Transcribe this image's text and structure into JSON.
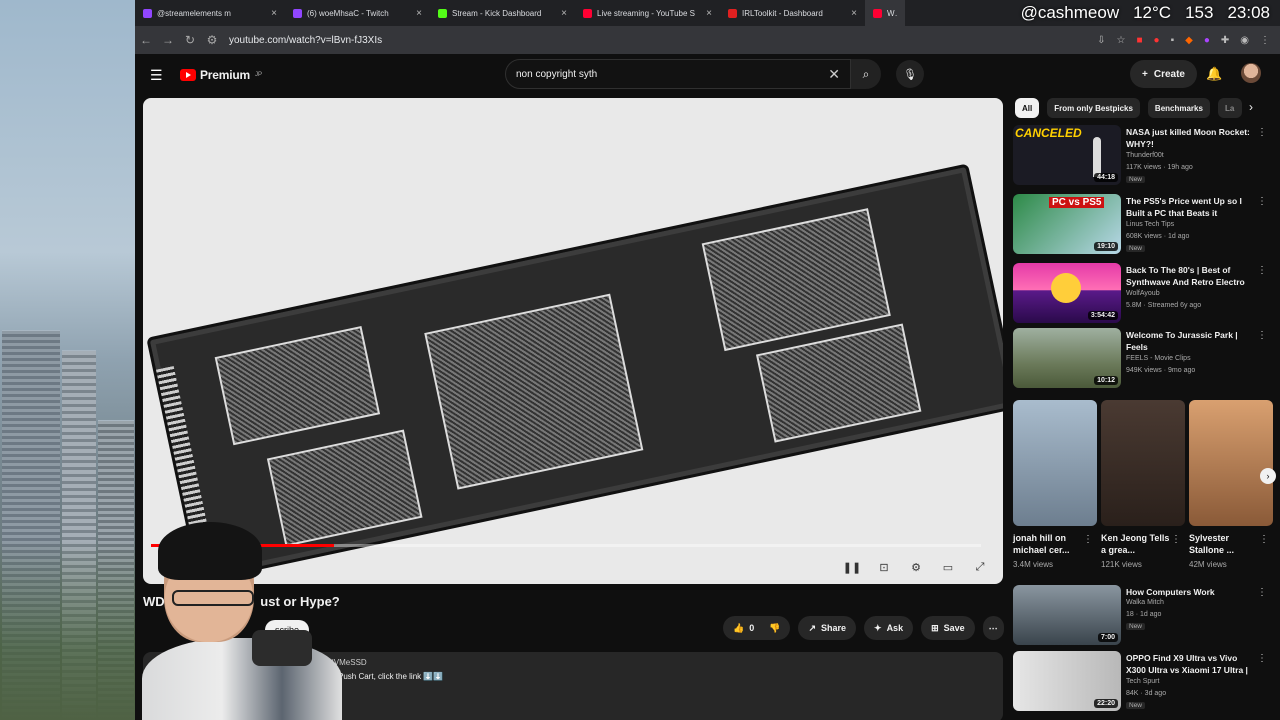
{
  "overlay": {
    "handle": "@cashmeow",
    "temp": "12°C",
    "count": "153",
    "time": "23:08"
  },
  "browser": {
    "tabs": [
      {
        "title": "@streamelements m",
        "color": "#9146ff"
      },
      {
        "title": "(6) woeMhsaC - Twitch",
        "color": "#9146ff"
      },
      {
        "title": "Stream - Kick Dashboard",
        "color": "#53fc18"
      },
      {
        "title": "Live streaming - YouTube S",
        "color": "#ff0033"
      },
      {
        "title": "IRLToolkit - Dashboard",
        "color": "#e02020"
      },
      {
        "title": "WD",
        "color": "#ff0033"
      }
    ],
    "url": "youtube.com/watch?v=lBvn-fJ3XIs"
  },
  "yt": {
    "logo": "Premium",
    "logo_sup": "JP",
    "search_value": "non copyright syth",
    "create_label": "Create"
  },
  "video": {
    "title_left": "WD",
    "title_right": "ust or Hype?",
    "subscribe": "scribe",
    "like_count": "0",
    "share": "Share",
    "ask": "Ask",
    "save": "Save",
    "desc_line1": "NVMeSSD",
    "desc_line2": "Push Cart, click the link ⬇️⬇️"
  },
  "chips": [
    "All",
    "From only Bestpicks",
    "Benchmarks",
    "La"
  ],
  "recs": [
    {
      "title": "NASA just killed Moon Rocket: WHY?!",
      "channel": "Thunderf00t",
      "meta": "117K views · 19h ago",
      "badge": "New",
      "duration": "44:18",
      "thumb_text": "CANCELED",
      "bg": "#1b1b24"
    },
    {
      "title": "The PS5's Price went Up so I Built a PC that Beats it",
      "channel": "Linus Tech Tips",
      "meta": "608K views · 1d ago",
      "badge": "New",
      "duration": "19:10",
      "thumb_text": "PC vs PS5",
      "bg": "#1f6f3a"
    },
    {
      "title": "Back To The 80's | Best of Synthwave And Retro Electro ...",
      "channel": "WolfAyoub",
      "meta": "5.8M · Streamed 6y ago",
      "badge": "",
      "duration": "3:54:42",
      "thumb_text": "",
      "bg": "#c12a8f"
    },
    {
      "title": "Welcome To Jurassic Park | Feels",
      "channel": "FEELS - Movie Clips",
      "meta": "949K views · 9mo ago",
      "badge": "",
      "duration": "10:12",
      "thumb_text": "",
      "bg": "#6b7a5a"
    }
  ],
  "shorts": [
    {
      "title": "jonah hill on michael cer...",
      "views": "3.4M views",
      "bg": "#8aa0b8"
    },
    {
      "title": "Ken Jeong Tells a grea...",
      "views": "121K views",
      "bg": "#5a4a40"
    },
    {
      "title": "Sylvester Stallone ...",
      "views": "42M views",
      "bg": "#b88660"
    }
  ],
  "recs2": [
    {
      "title": "How Computers Work",
      "channel": "Walka Mitch",
      "meta": "18 · 1d ago",
      "badge": "New",
      "duration": "7:00",
      "bg": "#4a5560"
    },
    {
      "title": "OPPO Find X9 Ultra vs Vivo X300 Ultra vs Xiaomi 17 Ultra | ...",
      "channel": "Tech Spurt",
      "meta": "84K · 3d ago",
      "badge": "New",
      "duration": "22:20",
      "bg": "#d8d8d8"
    }
  ]
}
